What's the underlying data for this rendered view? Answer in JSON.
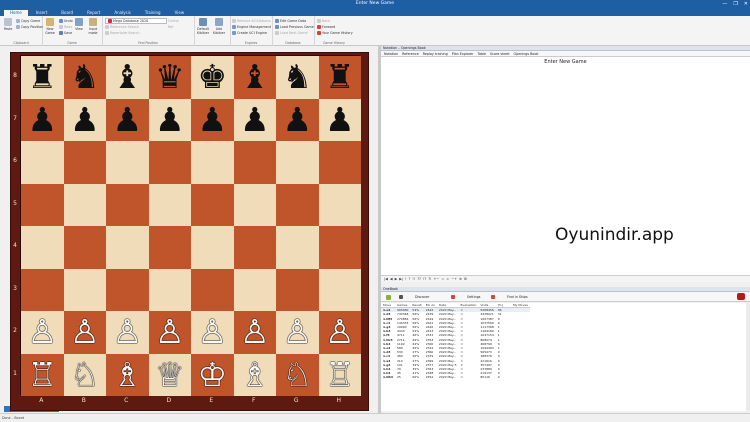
{
  "window": {
    "title": "Enter New Game",
    "controls": [
      "—",
      "❐",
      "✕"
    ]
  },
  "menu": {
    "tabs": [
      "File",
      "Home",
      "Insert",
      "Board",
      "Report",
      "Analysis",
      "Training",
      "View"
    ],
    "active": "Home"
  },
  "ribbon": {
    "clipboard": {
      "label": "Clipboard",
      "paste": "Paste",
      "items": [
        "Copy Game",
        "Copy Position"
      ]
    },
    "game": {
      "label": "Game",
      "items": [
        "Undo",
        "Redo",
        "Save"
      ],
      "new_game": "New Game",
      "view": "View",
      "input_mode": "Input mode"
    },
    "find_position": {
      "label": "Find Position",
      "db_select": "Mega Database 2020",
      "items": [
        "Reference Search",
        "Repertoire Search"
      ],
      "online": "Online",
      "ref": "Ref"
    },
    "engines": {
      "label": "Engines",
      "items": [
        "Default Kibitzer",
        "Add Kibitzer"
      ]
    },
    "engines2": {
      "items": [
        "Remove All Kibitzers",
        "Engine Management",
        "Create UCI Engine"
      ]
    },
    "database": {
      "label": "Database",
      "items": [
        "Edit Game Data",
        "Load Previous Game",
        "Load Next Game"
      ]
    },
    "game_history": {
      "label": "Game History",
      "items": [
        "Back",
        "Forward",
        "Your Game History"
      ]
    }
  },
  "board": {
    "files": [
      "A",
      "B",
      "C",
      "D",
      "E",
      "F",
      "G",
      "H"
    ],
    "ranks": [
      "8",
      "7",
      "6",
      "5",
      "4",
      "3",
      "2",
      "1"
    ],
    "rows": [
      [
        "♜",
        "♞",
        "♝",
        "♛",
        "♚",
        "♝",
        "♞",
        "♜"
      ],
      [
        "♟",
        "♟",
        "♟",
        "♟",
        "♟",
        "♟",
        "♟",
        "♟"
      ],
      [
        "",
        "",
        "",
        "",
        "",
        "",
        "",
        ""
      ],
      [
        "",
        "",
        "",
        "",
        "",
        "",
        "",
        ""
      ],
      [
        "",
        "",
        "",
        "",
        "",
        "",
        "",
        ""
      ],
      [
        "",
        "",
        "",
        "",
        "",
        "",
        "",
        ""
      ],
      [
        "♙",
        "♙",
        "♙",
        "♙",
        "♙",
        "♙",
        "♙",
        "♙"
      ],
      [
        "♖",
        "♘",
        "♗",
        "♕",
        "♔",
        "♗",
        "♘",
        "♖"
      ]
    ]
  },
  "notation": {
    "pane_title": "Notation – Openings Book",
    "tabs": [
      "Notation",
      "Reference",
      "Replay training",
      "Plan Explorer",
      "Table",
      "Score sheet",
      "Openings Book"
    ],
    "title": "Enter New Game"
  },
  "watermark": "Oyunindir.app",
  "nav_bar": [
    "|◀",
    "◀",
    "▶",
    "▶|",
    "!",
    "?",
    "!!",
    "??",
    "!?",
    "?!",
    "+−",
    "=",
    "∞",
    "−+",
    "⊕",
    "⊞"
  ],
  "openings": {
    "pane_title": "OneBook",
    "toolbar": [
      "Discover",
      "Settings",
      "Find in Ships"
    ],
    "columns": [
      "Move",
      "Games",
      "Result",
      "Elo Av",
      "Date",
      "Evaluation",
      "Visits",
      "[%]",
      "My Moves"
    ],
    "rows": [
      [
        "1.e4",
        "993930",
        "54%",
        "2422",
        "2020 May...",
        "=",
        "5268456",
        "46",
        ""
      ],
      [
        "1.d4",
        "740348",
        "56%",
        "2439",
        "2020 May...",
        "=",
        "3428021",
        "31",
        ""
      ],
      [
        "1.Nf3",
        "270856",
        "56%",
        "2429",
        "2020 May...",
        "=",
        "1007387",
        "9",
        ""
      ],
      [
        "1.c4",
        "144333",
        "56%",
        "2441",
        "2020 May...",
        "=",
        "1037590",
        "9",
        ""
      ],
      [
        "1.g3",
        "19000",
        "56%",
        "2426",
        "2020 May...",
        "=",
        "1117368",
        "1",
        ""
      ],
      [
        "1.b3",
        "4344",
        "52%",
        "2413",
        "2020 May...",
        "=",
        "1164180",
        "1",
        ""
      ],
      [
        "1.f4",
        "4711",
        "46%",
        "2331",
        "2020 May...",
        "=",
        "1047154",
        "1",
        ""
      ],
      [
        "1.Nc3",
        "2711",
        "49%",
        "2353",
        "2020 May...",
        "=",
        "868074",
        "1",
        ""
      ],
      [
        "1.b4",
        "1192",
        "44%",
        "2300",
        "2020 May...",
        "=",
        "468799",
        "0",
        ""
      ],
      [
        "1.e3",
        "580",
        "45%",
        "2312",
        "2020 May...",
        "=",
        "1094493",
        "1",
        ""
      ],
      [
        "1.d3",
        "530",
        "47%",
        "2360",
        "2020 May...",
        "=",
        "565473",
        "0",
        ""
      ],
      [
        "1.c3",
        "460",
        "46%",
        "2379",
        "2020 May...",
        "=",
        "188376",
        "0",
        ""
      ],
      [
        "1.a3",
        "210",
        "47%",
        "2399",
        "2020 May...",
        "=",
        "221616",
        "0",
        ""
      ],
      [
        "1.g4",
        "191",
        "39%",
        "2377",
        "2020 May 5",
        "∓",
        "357497",
        "0",
        ""
      ],
      [
        "1.h3",
        "79",
        "35%",
        "2353",
        "2020 May...",
        "=",
        "237889",
        "0",
        ""
      ],
      [
        "1.h4",
        "45",
        "41%",
        "2348",
        "2020 May...",
        "=",
        "219137",
        "0",
        ""
      ],
      [
        "1.Nh3",
        "25",
        "60%",
        "2452",
        "2020 May...",
        "=",
        "80116",
        "0",
        ""
      ]
    ]
  },
  "status": "Done – Board"
}
